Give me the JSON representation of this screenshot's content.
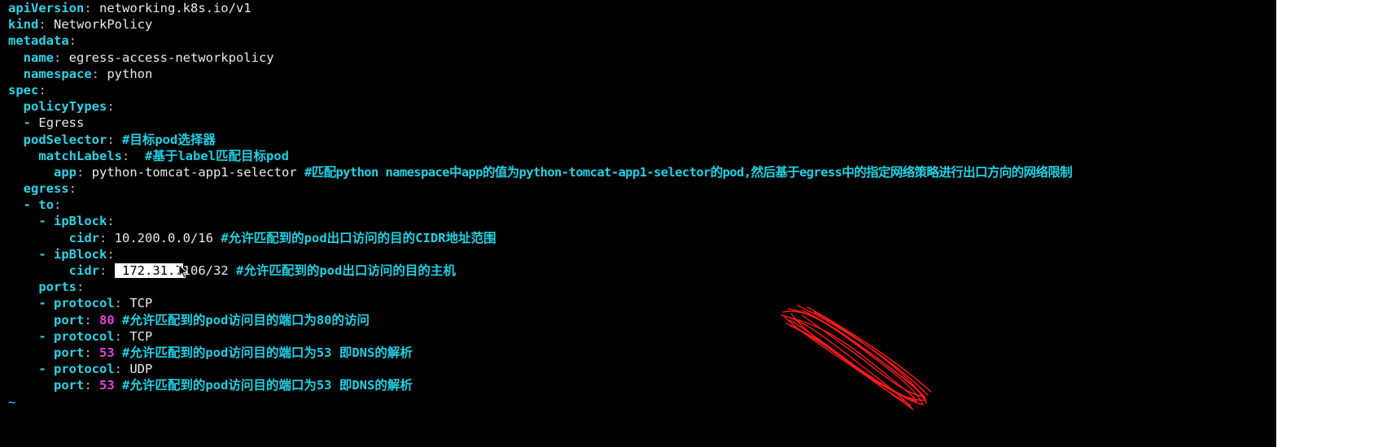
{
  "colors": {
    "background": "#000000",
    "key": "#2fd2e6",
    "colon": "#b5b5b5",
    "value": "#e9e9e9",
    "number": "#e243d8",
    "comment": "#21d0e4",
    "selection": "#ffffff",
    "annotation": "#ff1a1a",
    "tilde": "#2da0ff"
  },
  "lines": [
    {
      "key": "apiVersion",
      "value": "networking.k8s.io/v1"
    },
    {
      "key": "kind",
      "value": "NetworkPolicy"
    },
    {
      "key": "metadata"
    },
    {
      "key": "name",
      "value": "egress-access-networkpolicy"
    },
    {
      "key": "namespace",
      "value": "python"
    },
    {
      "key": "spec"
    },
    {
      "key": "policyTypes"
    },
    {
      "dash": "-",
      "value": "Egress"
    },
    {
      "key": "podSelector",
      "comment": "#目标pod选择器"
    },
    {
      "key": "matchLabels",
      "comment": "#基于label匹配目标pod"
    },
    {
      "key": "app",
      "value": "python-tomcat-app1-selector",
      "comment": "#匹配python namespace中app的值为python-tomcat-app1-selector的pod,然后基于egress中的指定网络策略进行出口方向的网络限制"
    },
    {
      "key": "egress"
    },
    {
      "dash": "-",
      "key": "to"
    },
    {
      "dash": "-",
      "key": "ipBlock"
    },
    {
      "key": "cidr",
      "value": "10.200.0.0/16",
      "comment": "#允许匹配到的pod出口访问的目的CIDR地址范围"
    },
    {
      "dash": "-",
      "key": "ipBlock"
    },
    {
      "key": "cidr",
      "value_selected": "172.31.7",
      "value_rest": "106/32",
      "comment": "#允许匹配到的pod出口访问的目的主机"
    },
    {
      "key": "ports"
    },
    {
      "dash": "-",
      "key": "protocol",
      "value": "TCP"
    },
    {
      "key": "port",
      "number": "80",
      "comment": "#允许匹配到的pod访问目的端口为80的访问"
    },
    {
      "dash": "-",
      "key": "protocol",
      "value": "TCP"
    },
    {
      "key": "port",
      "number": "53",
      "comment": "#允许匹配到的pod访问目的端口为53 即DNS的解析"
    },
    {
      "dash": "-",
      "key": "protocol",
      "value": "UDP"
    },
    {
      "key": "port",
      "number": "53",
      "comment": "#允许匹配到的pod访问目的端口为53 即DNS的解析"
    },
    {
      "tilde": "~"
    }
  ]
}
